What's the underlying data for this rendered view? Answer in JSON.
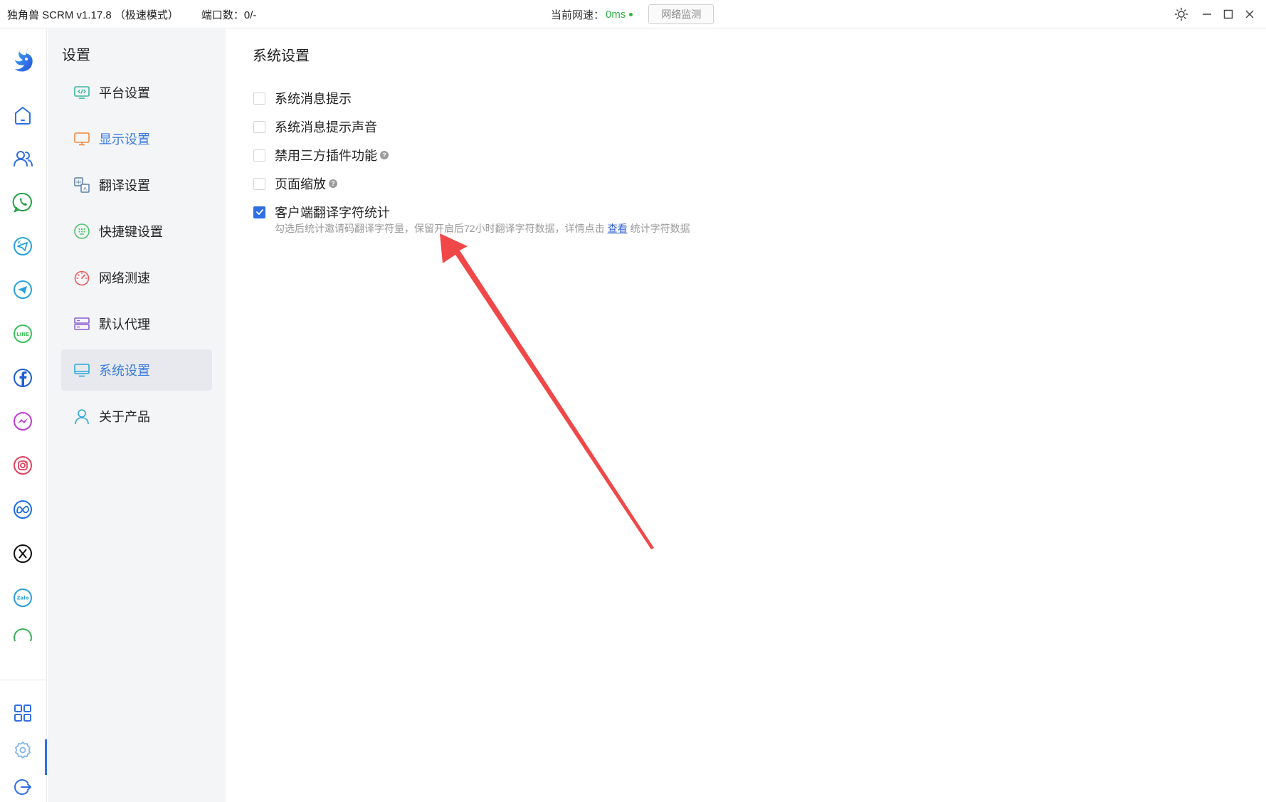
{
  "titlebar": {
    "app_title": "独角兽 SCRM v1.17.8 （极速模式）",
    "port_count": "端口数：0/-",
    "speed_label": "当前网速：",
    "speed_value": "0ms",
    "net_monitor_button": "网络监测"
  },
  "rail": {
    "items": [
      "logo-icon",
      "home-icon",
      "contacts-icon",
      "whatsapp-icon",
      "telegram-k-icon",
      "telegram-icon",
      "line-icon",
      "facebook-icon",
      "messenger-icon",
      "instagram-icon",
      "meta-icon",
      "x-icon",
      "zalo-icon"
    ],
    "bottom": [
      "apps-grid-icon",
      "settings-gear-icon",
      "logout-icon"
    ],
    "zalo_text": "Zalo",
    "line_text": "LINE"
  },
  "menu": {
    "title": "设置",
    "items": [
      {
        "label": "平台设置",
        "icon": "platform-code-icon"
      },
      {
        "label": "显示设置",
        "icon": "display-monitor-icon"
      },
      {
        "label": "翻译设置",
        "icon": "translate-icon"
      },
      {
        "label": "快捷键设置",
        "icon": "shortcut-keypad-icon"
      },
      {
        "label": "网络测速",
        "icon": "speedometer-icon"
      },
      {
        "label": "默认代理",
        "icon": "proxy-server-icon"
      },
      {
        "label": "系统设置",
        "icon": "system-monitor-icon"
      },
      {
        "label": "关于产品",
        "icon": "user-profile-icon"
      }
    ]
  },
  "content": {
    "title": "系统设置",
    "options": [
      {
        "label": "系统消息提示",
        "checked": false
      },
      {
        "label": "系统消息提示声音",
        "checked": false
      },
      {
        "label": "禁用三方插件功能",
        "checked": false,
        "help": "?"
      },
      {
        "label": "页面缩放",
        "checked": false,
        "help": "?"
      },
      {
        "label": "客户端翻译字符统计",
        "checked": true
      }
    ],
    "desc_before": "勾选后统计邀请码翻译字符量，保留开启后72小时翻译字符数据，详情点击",
    "desc_link": "查看",
    "desc_after": "统计字符数据"
  },
  "colors": {
    "accent": "#2f6fe4",
    "ping_green": "#2fb344",
    "arrow_red": "#f04848",
    "menu_bg": "#f4f5f7"
  }
}
